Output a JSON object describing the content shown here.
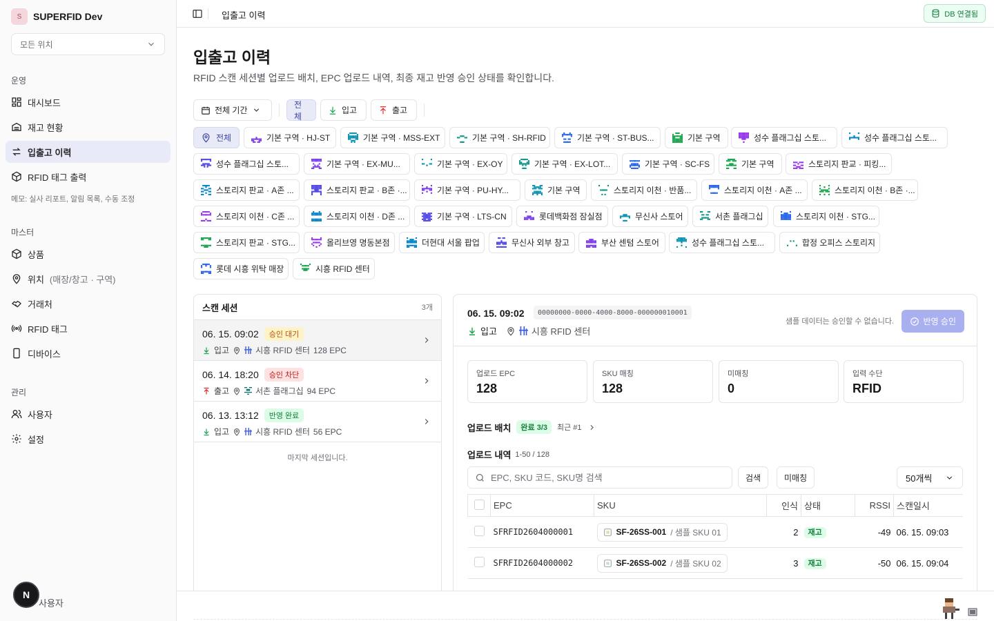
{
  "brand": {
    "initial": "S",
    "name": "SUPERFID Dev"
  },
  "location_select": {
    "value": "모든 위치"
  },
  "nav": {
    "group_ops": "운영",
    "dashboard": "대시보드",
    "inventory": "재고 현황",
    "history": "입출고 이력",
    "rfid_print": "RFID 태그 출력",
    "memo": "메모: 실사 리포트, 알림 목록, 수동 조정",
    "group_master": "마스터",
    "products": "상품",
    "location": "위치",
    "location_sub": "(매장/창고 · 구역)",
    "partners": "거래처",
    "rfid_tags": "RFID 태그",
    "devices": "디바이스",
    "group_admin": "관리",
    "users": "사용자",
    "settings": "설정"
  },
  "user": {
    "initial": "N",
    "name": "사용자"
  },
  "topbar": {
    "title": "입출고 이력",
    "db_status": "DB 연결됨"
  },
  "page": {
    "title": "입출고 이력",
    "description": "RFID 스캔 세션별 업로드 배치, EPC 업로드 내역, 최종 재고 반영 승인 상태를 확인합니다."
  },
  "filters": {
    "period": "전체 기간",
    "all": "전체",
    "in": "입고",
    "out": "출고"
  },
  "chips": [
    "전체",
    "기본 구역 · HJ-ST",
    "기본 구역 · MSS-EXT",
    "기본 구역 · SH-RFID",
    "기본 구역 · ST-BUS...",
    "기본 구역",
    "성수 플래그십 스토...",
    "성수 플래그십 스토...",
    "성수 플래그십 스토...",
    "기본 구역 · EX-MU...",
    "기본 구역 · EX-OY",
    "기본 구역 · EX-LOT...",
    "기본 구역 · SC-FS",
    "기본 구역",
    "스토리지 판교 · 피킹...",
    "스토리지 판교 · A존 ...",
    "스토리지 판교 · B존 ·...",
    "기본 구역 · PU-HY...",
    "기본 구역",
    "스토리지 이천 · 반품...",
    "스토리지 이천 · A존 ...",
    "스토리지 이천 · B존 ·...",
    "스토리지 이천 · C존 ...",
    "스토리지 이천 · D존 ...",
    "기본 구역 · LTS-CN",
    "롯데백화점 잠실점",
    "무신사 스토어",
    "서촌 플래그십",
    "스토리지 이천 · STG...",
    "스토리지 판교 · STG...",
    "올리브영 명동본점",
    "더현대 서울 팝업",
    "무신사 외부 창고",
    "부산 센텀 스토어",
    "성수 플래그십 스토...",
    "합정 오피스 스토리지",
    "롯데 시흥 위탁 매장",
    "시흥 RFID 센터"
  ],
  "sessions": {
    "title": "스캔 세션",
    "count": "3개",
    "items": [
      {
        "time": "06. 15. 09:02",
        "status": "승인 대기",
        "dir": "입고",
        "location": "시흥 RFID 센터",
        "epc": "128 EPC"
      },
      {
        "time": "06. 14. 18:20",
        "status": "승인 차단",
        "dir": "출고",
        "location": "서촌 플래그십",
        "epc": "94 EPC"
      },
      {
        "time": "06. 13. 13:12",
        "status": "반영 완료",
        "dir": "입고",
        "location": "시흥 RFID 센터",
        "epc": "56 EPC"
      }
    ],
    "end_note": "마지막 세션입니다."
  },
  "detail": {
    "time": "06. 15. 09:02",
    "uuid": "00000000-0000-4000-8000-000000010001",
    "dir": "입고",
    "location": "시흥 RFID 센터",
    "note": "샘플 데이터는 승인할 수 없습니다.",
    "approve": "반영 승인",
    "stats": [
      {
        "label": "업로드 EPC",
        "value": "128"
      },
      {
        "label": "SKU 매칭",
        "value": "128"
      },
      {
        "label": "미매칭",
        "value": "0"
      },
      {
        "label": "입력 수단",
        "value": "RFID"
      }
    ],
    "batch": {
      "title": "업로드 배치",
      "badge": "완료 3/3",
      "recent": "최근 #1"
    },
    "list": {
      "title": "업로드 내역",
      "range": "1-50 / 128"
    },
    "search_placeholder": "EPC, SKU 코드, SKU명 검색",
    "search_btn": "검색",
    "unmatched_btn": "미매칭",
    "page_size": "50개씩",
    "columns": {
      "epc": "EPC",
      "sku": "SKU",
      "count": "인식",
      "status": "상태",
      "rssi": "RSSI",
      "scanned": "스캔일시"
    },
    "rows": [
      {
        "epc": "SFRFID2604000001",
        "sku": "SF-26SS-001",
        "sku_name": "/ 샘플 SKU 01",
        "count": "2",
        "status": "재고",
        "rssi": "-49",
        "scanned": "06. 15. 09:03"
      },
      {
        "epc": "SFRFID2604000002",
        "sku": "SF-26SS-002",
        "sku_name": "/ 샘플 SKU 02",
        "count": "3",
        "status": "재고",
        "rssi": "-50",
        "scanned": "06. 15. 09:04"
      }
    ]
  }
}
